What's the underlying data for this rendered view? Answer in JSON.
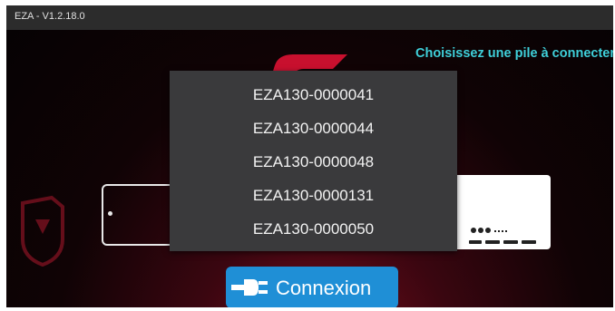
{
  "window": {
    "title": "EZA - V1.2.18.0"
  },
  "prompt": "Choisissez une pile à connecter",
  "device_list": {
    "items": [
      "EZA130-0000041",
      "EZA130-0000044",
      "EZA130-0000048",
      "EZA130-0000131",
      "EZA130-0000050"
    ]
  },
  "connect_button": {
    "label": "Connexion",
    "icon": "plug-icon"
  },
  "colors": {
    "accent_cyan": "#3fd0da",
    "button_blue": "#1f8fd6",
    "dropdown_bg": "#3a3a3c",
    "brand_red": "#c8102e"
  }
}
